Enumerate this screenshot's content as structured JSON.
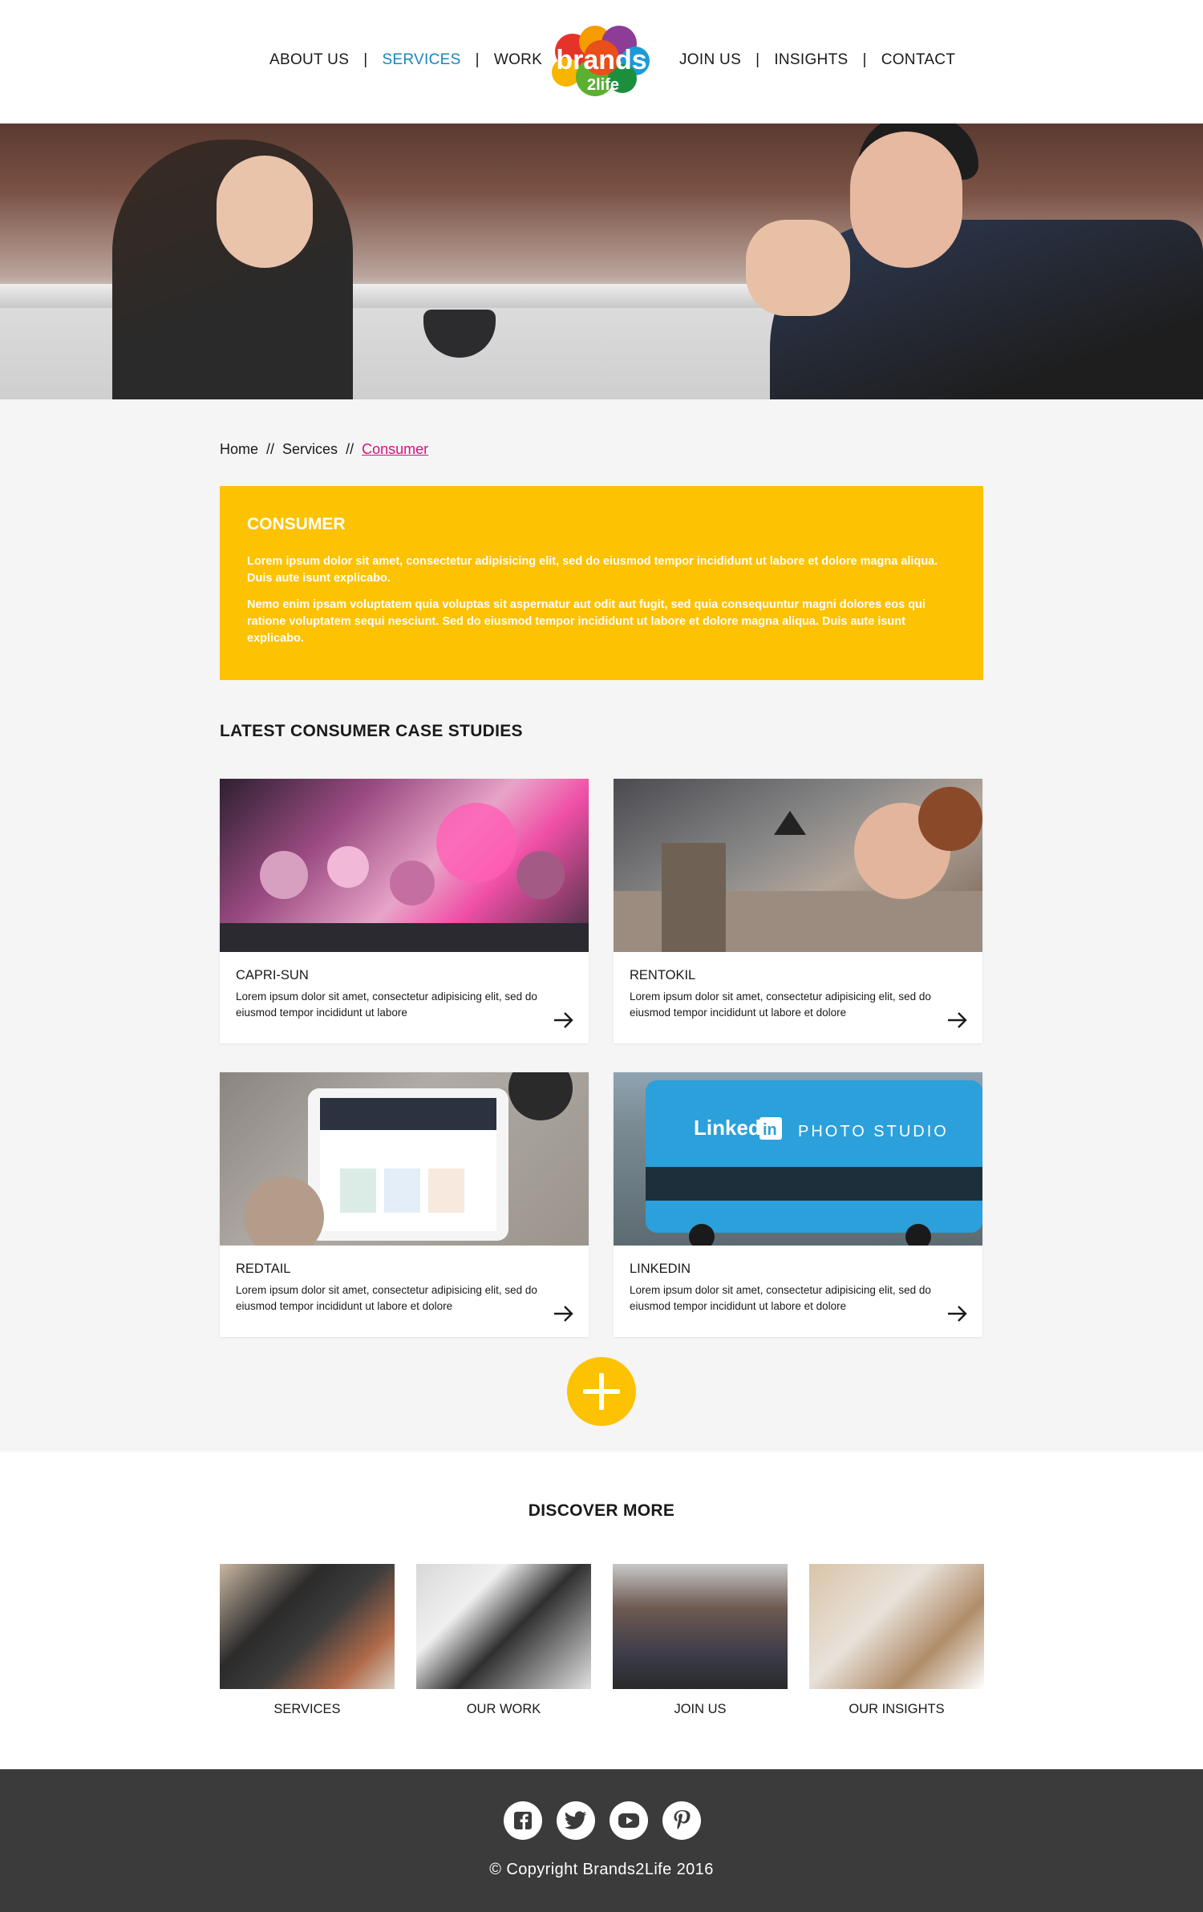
{
  "nav": {
    "left": [
      "ABOUT US",
      "SERVICES",
      "WORK"
    ],
    "right": [
      "JOIN US",
      "INSIGHTS",
      "CONTACT"
    ],
    "separator": "|",
    "active": "SERVICES",
    "active_color": "#1a86b8"
  },
  "logo": {
    "word": "brands",
    "sub": "2life"
  },
  "breadcrumb": {
    "home": "Home",
    "services": "Services",
    "current": "Consumer",
    "separator": "//"
  },
  "intro": {
    "title": "CONSUMER",
    "p1": "Lorem ipsum dolor sit amet, consectetur adipisicing elit, sed do eiusmod tempor incididunt ut labore et dolore magna aliqua. Duis aute isunt explicabo.",
    "p2": "Nemo enim ipsam voluptatem quia voluptas sit aspernatur aut odit aut fugit, sed quia consequuntur magni dolores eos qui ratione voluptatem sequi nesciunt. Sed do eiusmod tempor incididunt ut labore et dolore magna aliqua. Duis aute isunt explicabo.",
    "bg_color": "#fdc201"
  },
  "case_studies": {
    "title": "LATEST CONSUMER CASE STUDIES",
    "items": [
      {
        "title": "CAPRI-SUN",
        "desc": "Lorem ipsum dolor sit amet, consectetur adipisicing elit, sed do eiusmod tempor incididunt ut labore"
      },
      {
        "title": "RENTOKIL",
        "desc": "Lorem ipsum dolor sit amet, consectetur adipisicing elit, sed do eiusmod tempor incididunt ut labore et dolore"
      },
      {
        "title": "REDTAIL",
        "desc": "Lorem ipsum dolor sit amet, consectetur adipisicing elit, sed do eiusmod tempor incididunt ut labore et dolore"
      },
      {
        "title": "LINKEDIN",
        "desc": "Lorem ipsum dolor sit amet, consectetur adipisicing elit, sed do eiusmod tempor incididunt ut labore et dolore"
      }
    ],
    "linkedin_bus_text": "Linked",
    "linkedin_bus_in": "in",
    "linkedin_bus_studio": "PHOTO STUDIO"
  },
  "discover": {
    "title": "DISCOVER MORE",
    "items": [
      "SERVICES",
      "OUR WORK",
      "JOIN US",
      "OUR INSIGHTS"
    ]
  },
  "footer": {
    "social": [
      "facebook-icon",
      "twitter-icon",
      "youtube-icon",
      "pinterest-icon"
    ],
    "copyright": "© Copyright Brands2Life 2016"
  }
}
